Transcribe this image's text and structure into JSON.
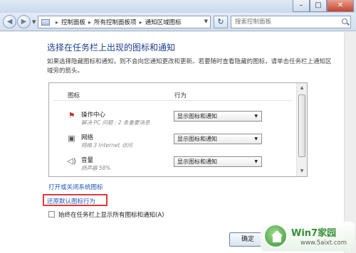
{
  "breadcrumb": [
    "控制面板",
    "所有控制面板项",
    "通知区域图标"
  ],
  "search": {
    "placeholder": "搜索控制面板"
  },
  "page": {
    "title": "选择在任务栏上出现的图标和通知",
    "description": "如果选择隐藏图标和通知，则不会向您通知更改和更新。若要随时查看隐藏的图标，请单击任务栏上通知区域旁的箭头。"
  },
  "table": {
    "headers": {
      "icon": "图标",
      "behavior": "行为"
    },
    "rows": [
      {
        "name": "操作中心",
        "sub": "解决 PC 问题 : 2 条重要消息",
        "icon": "action-center-flag-icon",
        "value": "显示图标和通知"
      },
      {
        "name": "网络",
        "sub": "网络 3 Internet 访问",
        "icon": "network-icon",
        "value": "显示图标和通知"
      },
      {
        "name": "音量",
        "sub": "扬声器 58%",
        "icon": "speaker-icon",
        "value": "显示图标和通知"
      }
    ]
  },
  "links": {
    "system_icons": "打开或关闭系统图标",
    "restore_default": "还原默认图标行为"
  },
  "checkbox": {
    "label": "始终在任务栏上显示所有图标和通知(A)",
    "checked": false
  },
  "ok_button": "确定",
  "watermark": {
    "title": "Win7家园",
    "url": "www.5aixt.com"
  },
  "colors": {
    "title": "#1a3e8d",
    "link": "#1f57b8",
    "highlight_box": "#e03a3a",
    "watermark_green": "#2d8a2a"
  }
}
